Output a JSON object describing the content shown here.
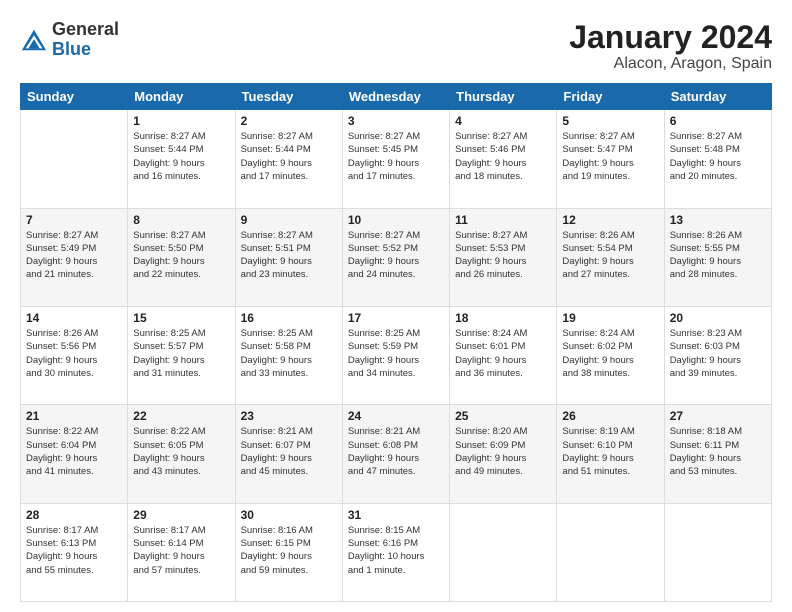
{
  "logo": {
    "general": "General",
    "blue": "Blue"
  },
  "header": {
    "month": "January 2024",
    "location": "Alacon, Aragon, Spain"
  },
  "days_of_week": [
    "Sunday",
    "Monday",
    "Tuesday",
    "Wednesday",
    "Thursday",
    "Friday",
    "Saturday"
  ],
  "weeks": [
    [
      {
        "day": "",
        "info": ""
      },
      {
        "day": "1",
        "info": "Sunrise: 8:27 AM\nSunset: 5:44 PM\nDaylight: 9 hours\nand 16 minutes."
      },
      {
        "day": "2",
        "info": "Sunrise: 8:27 AM\nSunset: 5:44 PM\nDaylight: 9 hours\nand 17 minutes."
      },
      {
        "day": "3",
        "info": "Sunrise: 8:27 AM\nSunset: 5:45 PM\nDaylight: 9 hours\nand 17 minutes."
      },
      {
        "day": "4",
        "info": "Sunrise: 8:27 AM\nSunset: 5:46 PM\nDaylight: 9 hours\nand 18 minutes."
      },
      {
        "day": "5",
        "info": "Sunrise: 8:27 AM\nSunset: 5:47 PM\nDaylight: 9 hours\nand 19 minutes."
      },
      {
        "day": "6",
        "info": "Sunrise: 8:27 AM\nSunset: 5:48 PM\nDaylight: 9 hours\nand 20 minutes."
      }
    ],
    [
      {
        "day": "7",
        "info": "Sunrise: 8:27 AM\nSunset: 5:49 PM\nDaylight: 9 hours\nand 21 minutes."
      },
      {
        "day": "8",
        "info": "Sunrise: 8:27 AM\nSunset: 5:50 PM\nDaylight: 9 hours\nand 22 minutes."
      },
      {
        "day": "9",
        "info": "Sunrise: 8:27 AM\nSunset: 5:51 PM\nDaylight: 9 hours\nand 23 minutes."
      },
      {
        "day": "10",
        "info": "Sunrise: 8:27 AM\nSunset: 5:52 PM\nDaylight: 9 hours\nand 24 minutes."
      },
      {
        "day": "11",
        "info": "Sunrise: 8:27 AM\nSunset: 5:53 PM\nDaylight: 9 hours\nand 26 minutes."
      },
      {
        "day": "12",
        "info": "Sunrise: 8:26 AM\nSunset: 5:54 PM\nDaylight: 9 hours\nand 27 minutes."
      },
      {
        "day": "13",
        "info": "Sunrise: 8:26 AM\nSunset: 5:55 PM\nDaylight: 9 hours\nand 28 minutes."
      }
    ],
    [
      {
        "day": "14",
        "info": "Sunrise: 8:26 AM\nSunset: 5:56 PM\nDaylight: 9 hours\nand 30 minutes."
      },
      {
        "day": "15",
        "info": "Sunrise: 8:25 AM\nSunset: 5:57 PM\nDaylight: 9 hours\nand 31 minutes."
      },
      {
        "day": "16",
        "info": "Sunrise: 8:25 AM\nSunset: 5:58 PM\nDaylight: 9 hours\nand 33 minutes."
      },
      {
        "day": "17",
        "info": "Sunrise: 8:25 AM\nSunset: 5:59 PM\nDaylight: 9 hours\nand 34 minutes."
      },
      {
        "day": "18",
        "info": "Sunrise: 8:24 AM\nSunset: 6:01 PM\nDaylight: 9 hours\nand 36 minutes."
      },
      {
        "day": "19",
        "info": "Sunrise: 8:24 AM\nSunset: 6:02 PM\nDaylight: 9 hours\nand 38 minutes."
      },
      {
        "day": "20",
        "info": "Sunrise: 8:23 AM\nSunset: 6:03 PM\nDaylight: 9 hours\nand 39 minutes."
      }
    ],
    [
      {
        "day": "21",
        "info": "Sunrise: 8:22 AM\nSunset: 6:04 PM\nDaylight: 9 hours\nand 41 minutes."
      },
      {
        "day": "22",
        "info": "Sunrise: 8:22 AM\nSunset: 6:05 PM\nDaylight: 9 hours\nand 43 minutes."
      },
      {
        "day": "23",
        "info": "Sunrise: 8:21 AM\nSunset: 6:07 PM\nDaylight: 9 hours\nand 45 minutes."
      },
      {
        "day": "24",
        "info": "Sunrise: 8:21 AM\nSunset: 6:08 PM\nDaylight: 9 hours\nand 47 minutes."
      },
      {
        "day": "25",
        "info": "Sunrise: 8:20 AM\nSunset: 6:09 PM\nDaylight: 9 hours\nand 49 minutes."
      },
      {
        "day": "26",
        "info": "Sunrise: 8:19 AM\nSunset: 6:10 PM\nDaylight: 9 hours\nand 51 minutes."
      },
      {
        "day": "27",
        "info": "Sunrise: 8:18 AM\nSunset: 6:11 PM\nDaylight: 9 hours\nand 53 minutes."
      }
    ],
    [
      {
        "day": "28",
        "info": "Sunrise: 8:17 AM\nSunset: 6:13 PM\nDaylight: 9 hours\nand 55 minutes."
      },
      {
        "day": "29",
        "info": "Sunrise: 8:17 AM\nSunset: 6:14 PM\nDaylight: 9 hours\nand 57 minutes."
      },
      {
        "day": "30",
        "info": "Sunrise: 8:16 AM\nSunset: 6:15 PM\nDaylight: 9 hours\nand 59 minutes."
      },
      {
        "day": "31",
        "info": "Sunrise: 8:15 AM\nSunset: 6:16 PM\nDaylight: 10 hours\nand 1 minute."
      },
      {
        "day": "",
        "info": ""
      },
      {
        "day": "",
        "info": ""
      },
      {
        "day": "",
        "info": ""
      }
    ]
  ]
}
